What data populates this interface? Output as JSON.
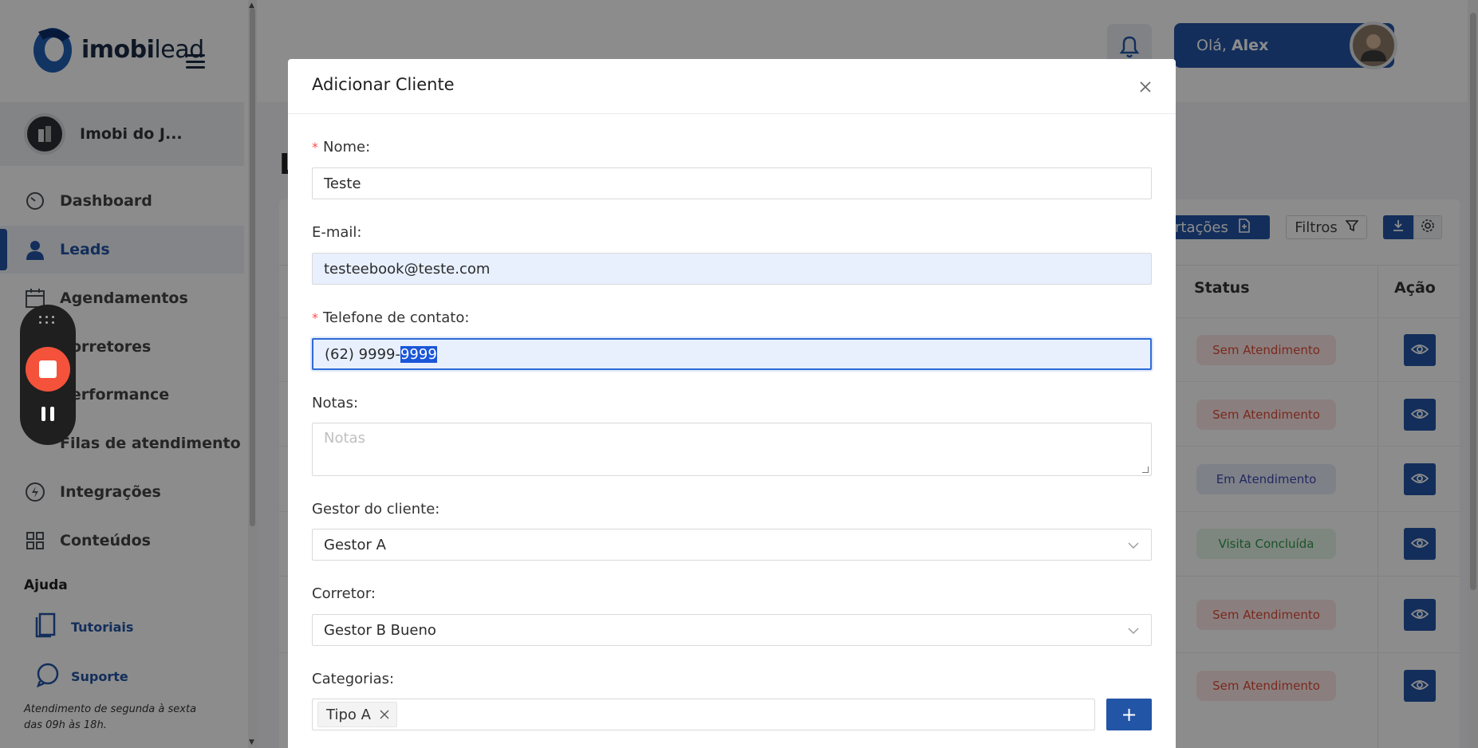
{
  "brand": {
    "name_regular": "imobi",
    "name_light": "lead"
  },
  "account": {
    "name": "Imobi do J..."
  },
  "sidebar": {
    "items": [
      {
        "label": "Dashboard",
        "icon": "dashboard-gauge-icon"
      },
      {
        "label": "Leads",
        "icon": "person-icon",
        "active": true
      },
      {
        "label": "Agendamentos",
        "icon": "calendar-icon"
      },
      {
        "label": "Corretores",
        "icon": "users-icon"
      },
      {
        "label": "Performance",
        "icon": "chart-icon"
      },
      {
        "label": "Filas de atendimento",
        "icon": "queue-icon"
      },
      {
        "label": "Integrações",
        "icon": "lightning-icon"
      },
      {
        "label": "Conteúdos",
        "icon": "grid-icon"
      }
    ],
    "help_title": "Ajuda",
    "help_links": [
      {
        "label": "Tutoriais",
        "icon": "book-icon"
      },
      {
        "label": "Suporte",
        "icon": "whatsapp-icon"
      }
    ],
    "help_note": "Atendimento de segunda à sexta das 09h às 18h."
  },
  "header": {
    "greeting": "Olá,",
    "user_name": "Alex"
  },
  "page": {
    "heading": "L",
    "toolbar": {
      "imports_label": "ortações",
      "filters_label": "Filtros"
    },
    "columns": {
      "status": "Status",
      "action": "Ação"
    },
    "rows": [
      {
        "status": "Sem Atendimento",
        "tone": "red"
      },
      {
        "status": "Sem Atendimento",
        "tone": "red"
      },
      {
        "status": "Em Atendimento",
        "tone": "blue"
      },
      {
        "status": "Visita Concluída",
        "tone": "green"
      },
      {
        "status": "Sem Atendimento",
        "tone": "red"
      },
      {
        "status": "Sem Atendimento",
        "tone": "red"
      }
    ]
  },
  "modal": {
    "title": "Adicionar Cliente",
    "fields": {
      "name": {
        "label": "Nome:",
        "value": "Teste",
        "required": true
      },
      "email": {
        "label": "E-mail:",
        "value": "testeebook@teste.com"
      },
      "phone": {
        "label": "Telefone de contato:",
        "value_unselected": "(62) 9999-",
        "value_selected": "9999",
        "required": true
      },
      "notes": {
        "label": "Notas:",
        "placeholder": "Notas"
      },
      "manager": {
        "label": "Gestor do cliente:",
        "value": "Gestor A"
      },
      "broker": {
        "label": "Corretor:",
        "value": "Gestor B Bueno"
      },
      "categories": {
        "label": "Categorias:",
        "tags": [
          "Tipo A"
        ],
        "add_label": "+"
      }
    }
  },
  "colors": {
    "primary": "#2355a6",
    "danger": "#e04a3a",
    "recording": "#f4523b"
  }
}
